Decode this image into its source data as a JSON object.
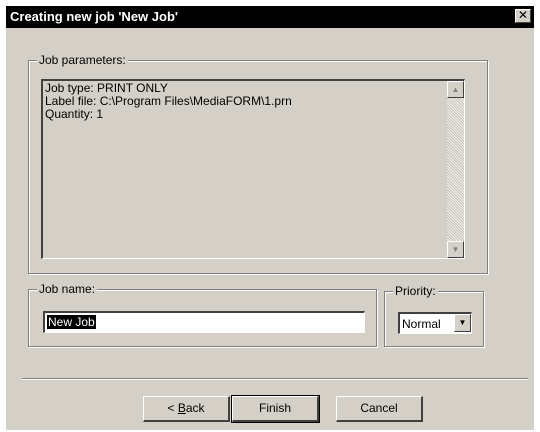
{
  "window": {
    "title": "Creating new job 'New Job'",
    "close_glyph": "✕"
  },
  "job_parameters": {
    "label": "Job parameters:",
    "lines": [
      "Job type: PRINT ONLY",
      "Label file: C:\\Program Files\\MediaFORM\\1.prn",
      "Quantity: 1"
    ],
    "scroll_up_glyph": "▲",
    "scroll_down_glyph": "▼"
  },
  "job_name": {
    "label": "Job name:",
    "value": "New Job"
  },
  "priority": {
    "label": "Priority:",
    "value": "Normal",
    "arrow_glyph": "▼"
  },
  "buttons": {
    "back_prefix": "< ",
    "back_mnemonic": "B",
    "back_rest": "ack",
    "finish": "Finish",
    "cancel": "Cancel"
  },
  "colors": {
    "dialog_face": "#d4d0c8",
    "titlebar": "#000000",
    "selection": "#000000"
  }
}
